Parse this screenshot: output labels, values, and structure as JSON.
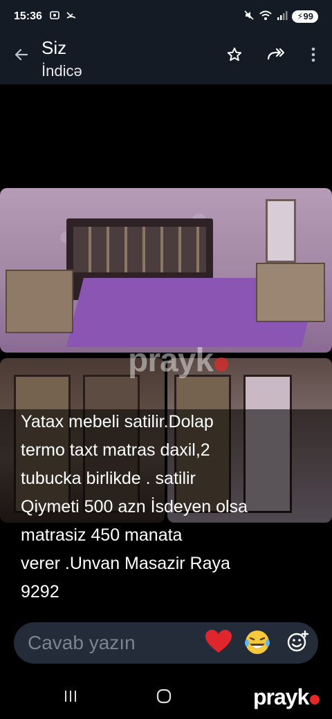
{
  "status_bar": {
    "time": "15:36",
    "battery": "99",
    "icons": [
      "screenshot-icon",
      "missed-call-icon",
      "mute-icon",
      "wifi-icon",
      "signal-icon"
    ]
  },
  "header": {
    "title": "Siz",
    "subtitle": "İndicə",
    "icons": [
      "back-arrow-icon",
      "star-icon",
      "forward-icon",
      "more-icon"
    ]
  },
  "watermark": {
    "text": "prayk"
  },
  "caption": {
    "text": "Yatax mebeli satilir.Dolap\ntermo taxt matras daxil,2\ntubucka  birlikde . satilir\nQiymeti  500 azn  İsdeyen olsa\nmatrasiz 450 manata\nverer .Unvan Masazir  Raya\n9292"
  },
  "reply": {
    "placeholder": "Cavab yazın",
    "icons": [
      "heart-icon",
      "laughing-emoji-icon",
      "emoji-add-icon"
    ]
  },
  "nav": {
    "brand": "prayk",
    "icons": [
      "recent-apps-icon",
      "home-icon"
    ]
  },
  "colors": {
    "background": "#000000",
    "header_bg": "#141b25",
    "reply_bg": "#232c38",
    "heart": "#e0262d",
    "brand_dot": "#e62828"
  }
}
